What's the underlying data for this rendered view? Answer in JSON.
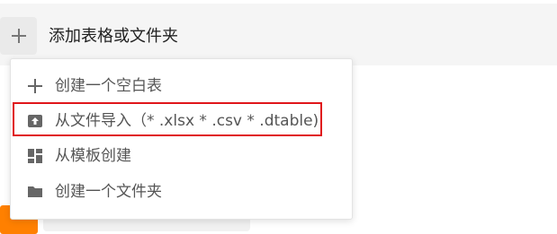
{
  "header": {
    "add_icon": "plus-icon",
    "title": "添加表格或文件夹"
  },
  "menu": {
    "items": [
      {
        "label": "创建一个空白表",
        "icon": "plus-icon"
      },
      {
        "label": "从文件导入（* .xlsx * .csv * .dtable)",
        "icon": "file-upload-icon"
      },
      {
        "label": "从模板创建",
        "icon": "template-icon"
      },
      {
        "label": "创建一个文件夹",
        "icon": "folder-icon"
      }
    ]
  },
  "colors": {
    "highlight": "#e0161a",
    "accent_orange": "#ff8000",
    "icon_gray": "#666666"
  }
}
